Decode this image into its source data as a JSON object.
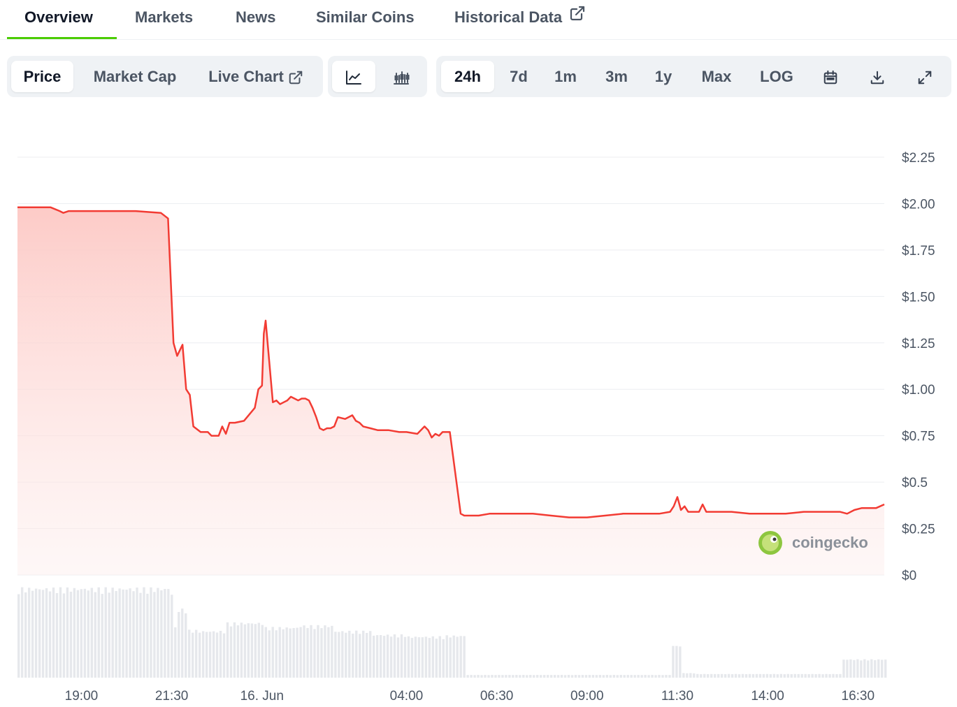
{
  "tabs": {
    "overview": "Overview",
    "markets": "Markets",
    "news": "News",
    "similar": "Similar Coins",
    "historical": "Historical Data"
  },
  "toolbar": {
    "price": "Price",
    "market_cap": "Market Cap",
    "live_chart": "Live Chart",
    "ranges": [
      "24h",
      "7d",
      "1m",
      "3m",
      "1y",
      "Max"
    ],
    "log": "LOG",
    "active_metric": "Price",
    "active_range": "24h",
    "active_view": "line"
  },
  "icons": {
    "external": "external-link-icon",
    "line": "line-chart-icon",
    "candle": "candlestick-icon",
    "calendar": "calendar-icon",
    "download": "download-icon",
    "fullscreen": "expand-icon"
  },
  "colors": {
    "line": "#f23b33",
    "fill_top": "#fdc8c4",
    "active_tab": "#4bcc00",
    "volume": "#e6e8ec"
  },
  "watermark": "coingecko",
  "chart_data": {
    "type": "area",
    "y_ticks": [
      "$0",
      "$0.25",
      "$0.5",
      "$0.75",
      "$1.00",
      "$1.25",
      "$1.50",
      "$1.75",
      "$2.00",
      "$2.25"
    ],
    "y_tick_values": [
      0,
      0.25,
      0.5,
      0.75,
      1.0,
      1.25,
      1.5,
      1.75,
      2.0,
      2.25
    ],
    "ylim": [
      0,
      2.25
    ],
    "xlim": [
      17.23,
      41.23
    ],
    "x_ticks": [
      "19:00",
      "21:30",
      "16. Jun",
      "04:00",
      "06:30",
      "09:00",
      "11:30",
      "14:00",
      "16:30"
    ],
    "x_tick_values": [
      19,
      21.5,
      24,
      28,
      30.5,
      33,
      35.5,
      38,
      40.5
    ],
    "grid": true,
    "series": [
      {
        "x": [
          17.23,
          18.15,
          18.4,
          18.5,
          18.65,
          19.5,
          20.5,
          21.2,
          21.4,
          21.55,
          21.65,
          21.8,
          21.9,
          22.0,
          22.1,
          22.3,
          22.5,
          22.6,
          22.8,
          22.9,
          23.0,
          23.1,
          23.25,
          23.5,
          23.8,
          23.9,
          24.0,
          24.05,
          24.1,
          24.3,
          24.4,
          24.5,
          24.6,
          24.7,
          24.8,
          24.9,
          25.0,
          25.1,
          25.2,
          25.3,
          25.4,
          25.5,
          25.6,
          25.7,
          25.8,
          25.9,
          26.0,
          26.1,
          26.3,
          26.5,
          26.6,
          26.7,
          26.8,
          27.0,
          27.2,
          27.5,
          27.8,
          28.0,
          28.3,
          28.5,
          28.6,
          28.7,
          28.8,
          28.9,
          29.0,
          29.2,
          29.5,
          29.6,
          29.8,
          30.0,
          30.3,
          30.5,
          30.8,
          31.5,
          32.0,
          32.5,
          33.0,
          33.5,
          34.0,
          34.5,
          35.0,
          35.3,
          35.4,
          35.5,
          35.6,
          35.7,
          35.8,
          35.9,
          36.1,
          36.2,
          36.3,
          36.4,
          36.6,
          37.0,
          37.5,
          38.0,
          38.5,
          39.0,
          39.5,
          40.0,
          40.2,
          40.4,
          40.6,
          41.0,
          41.23
        ],
        "y": [
          1.98,
          1.98,
          1.96,
          1.95,
          1.96,
          1.96,
          1.96,
          1.95,
          1.92,
          1.25,
          1.18,
          1.24,
          1.0,
          0.97,
          0.8,
          0.77,
          0.77,
          0.75,
          0.75,
          0.8,
          0.76,
          0.82,
          0.82,
          0.83,
          0.9,
          1.0,
          1.02,
          1.3,
          1.37,
          0.93,
          0.94,
          0.92,
          0.93,
          0.94,
          0.96,
          0.95,
          0.94,
          0.95,
          0.95,
          0.94,
          0.9,
          0.85,
          0.79,
          0.78,
          0.79,
          0.79,
          0.8,
          0.85,
          0.84,
          0.86,
          0.83,
          0.82,
          0.8,
          0.79,
          0.78,
          0.78,
          0.77,
          0.77,
          0.76,
          0.8,
          0.78,
          0.74,
          0.76,
          0.75,
          0.77,
          0.77,
          0.33,
          0.32,
          0.32,
          0.32,
          0.33,
          0.33,
          0.33,
          0.33,
          0.32,
          0.31,
          0.31,
          0.32,
          0.33,
          0.33,
          0.33,
          0.34,
          0.37,
          0.42,
          0.35,
          0.37,
          0.34,
          0.34,
          0.34,
          0.38,
          0.34,
          0.34,
          0.34,
          0.34,
          0.33,
          0.33,
          0.33,
          0.34,
          0.34,
          0.34,
          0.33,
          0.35,
          0.36,
          0.36,
          0.38
        ]
      }
    ],
    "volume": {
      "description_free": true,
      "x": [
        17.23,
        21.4,
        21.5,
        21.6,
        21.9,
        22.2,
        23.0,
        24.0,
        25.0,
        26.0,
        27.0,
        28.0,
        29.0,
        29.6,
        30.0,
        35.0,
        35.3,
        35.6,
        36.0,
        39.0,
        40.0,
        41.23
      ],
      "y": [
        0.98,
        0.93,
        0.55,
        0.75,
        0.52,
        0.51,
        0.6,
        0.55,
        0.57,
        0.51,
        0.47,
        0.45,
        0.46,
        0.03,
        0.03,
        0.03,
        0.35,
        0.05,
        0.04,
        0.04,
        0.2,
        0.18
      ]
    }
  }
}
